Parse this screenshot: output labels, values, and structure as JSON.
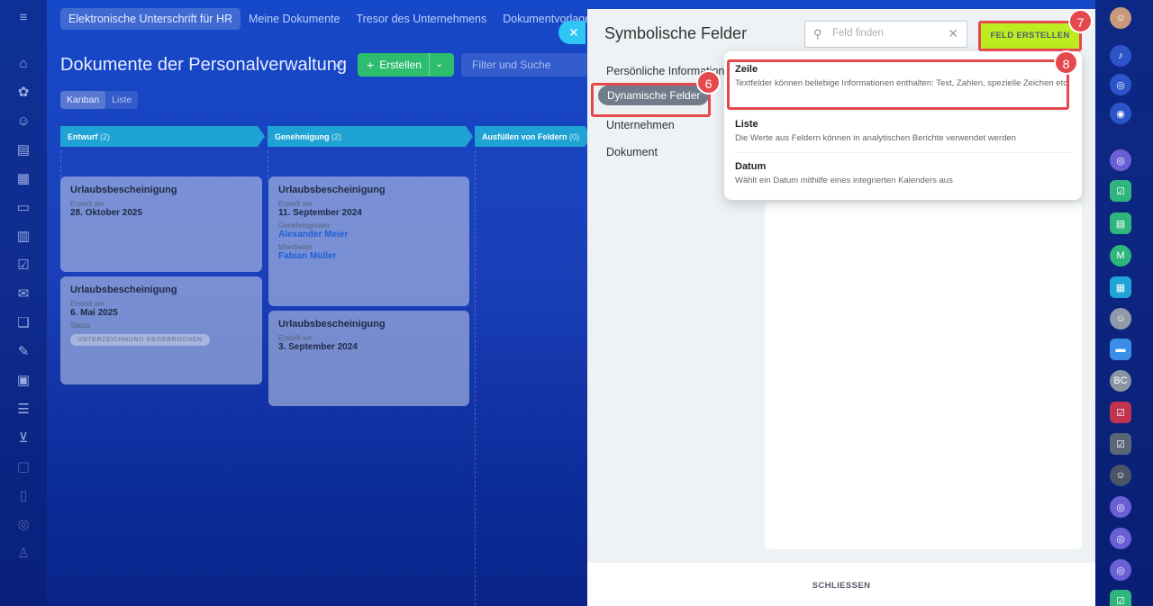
{
  "topnav": {
    "tabs": [
      "Elektronische Unterschrift für HR",
      "Meine Dokumente",
      "Tresor des Unternehmens",
      "Dokumentvorlagen"
    ]
  },
  "page": {
    "title": "Dokumente der Personalverwaltung",
    "create_label": "Erstellen",
    "filter_placeholder": "Filter und Suche",
    "views": [
      "Kanban",
      "Liste"
    ]
  },
  "columns": [
    {
      "label": "Entwurf",
      "count": "(2)"
    },
    {
      "label": "Genehmigung",
      "count": "(2)"
    },
    {
      "label": "Ausfüllen von Feldern",
      "count": "(0)"
    }
  ],
  "cards": [
    {
      "title": "Urlaubsbescheinigung",
      "created_label": "Erstellt am",
      "date": "28. Oktober 2025"
    },
    {
      "title": "Urlaubsbescheinigung",
      "created_label": "Erstellt am",
      "date": "6. Mai 2025",
      "status_label": "Status",
      "status": "UNTERZEICHNUNG ABGEBROCHEN"
    },
    {
      "title": "Urlaubsbescheinigung",
      "created_label": "Erstellt am",
      "date": "11. September 2024",
      "approver_label": "Genehmigender",
      "approver": "Alexander Meier",
      "employee_label": "Mitarbeiter",
      "employee": "Fabian Müller"
    },
    {
      "title": "Urlaubsbescheinigung",
      "created_label": "Erstellt am",
      "date": "3. September 2024"
    }
  ],
  "panel": {
    "title": "Symbolische Felder",
    "search_placeholder": "Feld finden",
    "create_button": "FELD ERSTELLEN",
    "menu": [
      "Persönliche Informationen",
      "Dynamische Felder",
      "Unternehmen",
      "Dokument"
    ],
    "close_label": "SCHLIESSEN"
  },
  "popup": {
    "options": [
      {
        "title": "Zeile",
        "desc": "Textfelder können beliebige Informationen enthalten: Text, Zahlen, spezielle Zeichen etc."
      },
      {
        "title": "Liste",
        "desc": "Die Werte aus Feldern können in analytischen Berichte verwendet werden"
      },
      {
        "title": "Datum",
        "desc": "Wählt ein Datum mithilfe eines integrierten Kalenders aus"
      }
    ]
  },
  "annotations": {
    "step6": "6",
    "step7": "7",
    "step8": "8"
  },
  "right_sidebar": {
    "initials": [
      "M",
      "BC"
    ]
  },
  "colors": {
    "accent_green": "#bbed21",
    "highlight_red": "#e5484d",
    "column_header": "#1ea3d4",
    "create_button": "#2ebd6f"
  },
  "icons": [
    "menu-icon",
    "home-icon",
    "close-icon",
    "search-icon",
    "pin-icon",
    "plus-icon",
    "chevron-down-icon",
    "bell-icon"
  ]
}
